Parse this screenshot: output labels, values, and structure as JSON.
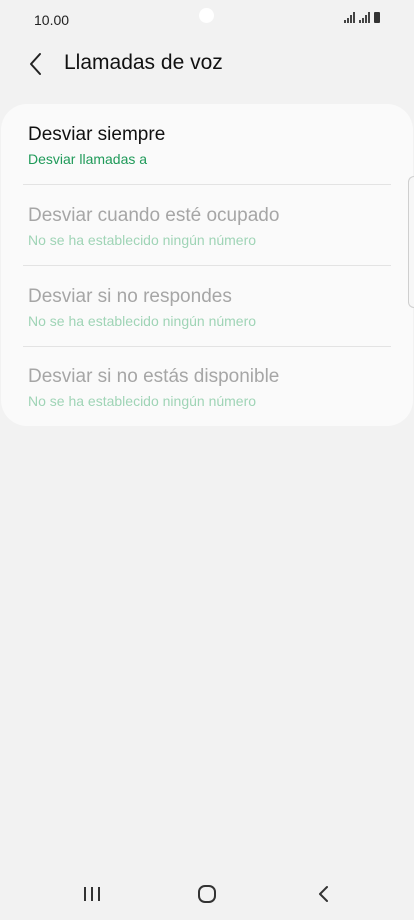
{
  "status_bar": {
    "time": "10.00"
  },
  "header": {
    "title": "Llamadas de voz",
    "back_icon": "chevron-left-icon"
  },
  "forwarding_options": [
    {
      "title": "Desviar siempre",
      "subtitle": "Desviar llamadas a",
      "enabled": true
    },
    {
      "title": "Desviar cuando esté ocupado",
      "subtitle": "No se ha establecido ningún número",
      "enabled": false
    },
    {
      "title": "Desviar si no respondes",
      "subtitle": "No se ha establecido ningún número",
      "enabled": false
    },
    {
      "title": "Desviar si no estás disponible",
      "subtitle": "No se ha establecido ningún número",
      "enabled": false
    }
  ],
  "colors": {
    "accent_green": "#1f9a59",
    "disabled_green": "#9fd4b6",
    "background": "#f2f2f2",
    "card": "#fafafa"
  },
  "nav_bar": {
    "icons": [
      "recent-apps-icon",
      "home-icon",
      "back-icon"
    ]
  }
}
